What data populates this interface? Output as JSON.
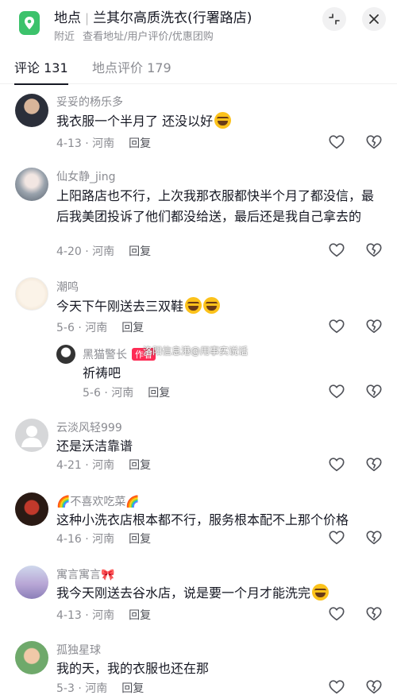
{
  "header": {
    "kind": "地点",
    "name": "兰其尔高质洗衣(行署路店)",
    "nearby": "附近",
    "links": "查看地址/用户评价/优惠团购",
    "colors": {
      "accent": "#3cc26b"
    }
  },
  "tabs": {
    "comments": "评论 131",
    "reviews": "地点评价 179"
  },
  "watermark": "洛阳信息港@用事实说话",
  "comments": [
    {
      "user": "妥妥的杨乐多",
      "text": "我衣服一个半月了 还没以好",
      "emoji": true,
      "date": "4-13 · 河南",
      "reply": "回复"
    },
    {
      "user": "仙女静_jing",
      "text": "上阳路店也不行，上次我那衣服都快半个月了都没信，最后我美团投诉了他们都没给送，最后还是我自己拿去的",
      "date": "4-20 · 河南",
      "reply": "回复"
    },
    {
      "user": "潮鸣",
      "text": "今天下午刚送去三双鞋",
      "date": "5-6 · 河南",
      "reply": "回复"
    },
    {
      "user": "黑猫警长",
      "badge": "作者",
      "text": "祈祷吧",
      "date": "5-6 · 河南",
      "reply": "回复"
    },
    {
      "user": "云淡风轻999",
      "text": "还是沃洁靠谱",
      "date": "4-21 · 河南",
      "reply": "回复"
    },
    {
      "user": "🌈不喜欢吃菜🌈",
      "text": "这种小洗衣店根本都不行，服务根本配不上那个价格",
      "date": "4-16 · 河南",
      "reply": "回复"
    },
    {
      "user": "寓言寓言🎀",
      "text": "我今天刚送去谷水店，说是要一个月才能洗完",
      "date": "4-13 · 河南",
      "reply": "回复"
    },
    {
      "user": "孤独星球",
      "text": "我的天，我的衣服也还在那",
      "date": "5-3 · 河南",
      "reply": "回复"
    }
  ]
}
